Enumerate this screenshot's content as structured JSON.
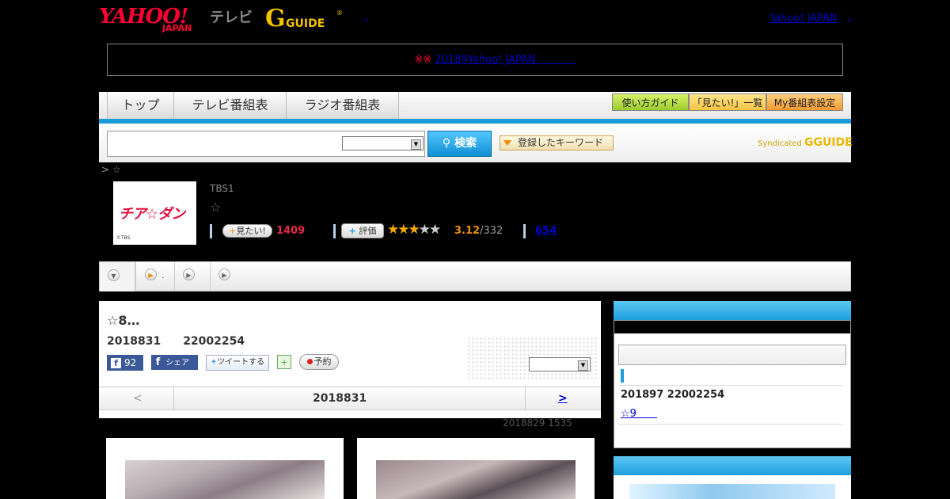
{
  "header": {
    "yahoo_logo_text": "YAHOO!",
    "yahoo_logo_sub": "JAPAN",
    "tv_label": "テレビ",
    "gguide_logo_text": "GUIDE",
    "top_link": "Yahoo! JAPAN"
  },
  "notice": {
    "marks": "※※",
    "link_text": "20189Yahoo! JAPAN　　　　"
  },
  "nav": {
    "tabs": [
      "トップ",
      "テレビ番組表",
      "ラジオ番組表"
    ],
    "help_buttons": [
      "使い方ガイド",
      "「見たい!」一覧",
      "My番組表設定"
    ]
  },
  "search": {
    "button_label": "検索",
    "keyword_button": "登録したキーワード",
    "syndicated_label": "Syndicated",
    "syndicated_logo": "GUIDE",
    "search_icon": "search-icon"
  },
  "breadcrumb": "> ☆",
  "program": {
    "thumb_title": "チア☆ダン",
    "thumb_copyright": "©TBS",
    "channel": "TBS1",
    "title_star": "☆",
    "mitai_label": "見たい!",
    "mitai_count": "1409",
    "hyoka_label": "評価",
    "rating": 3.12,
    "rating_text": "3.12",
    "rating_count": "/332",
    "review_count": "654",
    "accent_color": "#e5284b",
    "rating_color": "#f28c00"
  },
  "subtabs": {
    "dot_label": "."
  },
  "episode": {
    "title": "☆8…",
    "date_line": "2018831　　22002254",
    "fb_count": "92",
    "fb_share": "シェア",
    "tweet_label": "ツイートする",
    "reserve_label": "予約",
    "nav_prev": "<",
    "nav_current": "2018831",
    "nav_next": ">",
    "updated": "2018829  1535"
  },
  "sidebar": {
    "date_line": "201897  22002254",
    "link_text": "☆9　　"
  }
}
